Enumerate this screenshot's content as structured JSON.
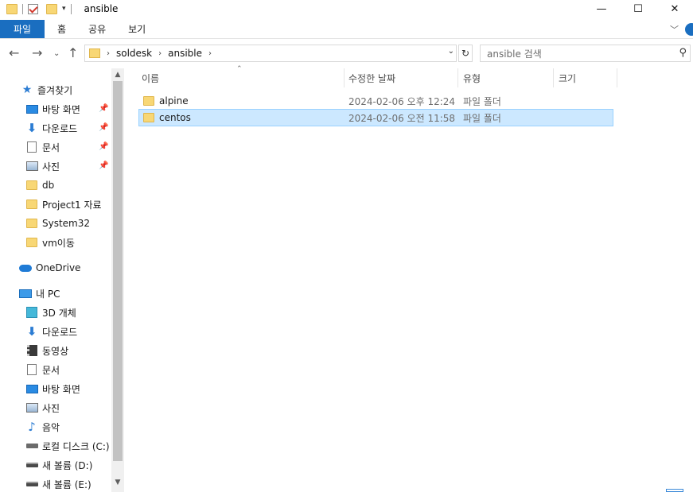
{
  "window": {
    "title": "ansible",
    "controls": {
      "minimize": "—",
      "maximize": "☐",
      "close": "✕"
    }
  },
  "ribbon": {
    "tabs": [
      "파일",
      "홈",
      "공유",
      "보기"
    ],
    "expand_icon": "chevron-down-icon"
  },
  "address": {
    "breadcrumb": [
      "soldesk",
      "ansible"
    ],
    "search_placeholder": "ansible 검색"
  },
  "sidebar": {
    "quick_access": {
      "label": "즐겨찾기"
    },
    "quick_items": [
      {
        "label": "바탕 화면",
        "icon": "desktop-icon",
        "pinned": true
      },
      {
        "label": "다운로드",
        "icon": "download-icon",
        "pinned": true
      },
      {
        "label": "문서",
        "icon": "document-icon",
        "pinned": true
      },
      {
        "label": "사진",
        "icon": "picture-icon",
        "pinned": true
      },
      {
        "label": "db",
        "icon": "folder-icon",
        "pinned": false
      },
      {
        "label": "Project1 자료",
        "icon": "folder-icon",
        "pinned": false
      },
      {
        "label": "System32",
        "icon": "folder-icon",
        "pinned": false
      },
      {
        "label": "vm이동",
        "icon": "folder-icon",
        "pinned": false
      }
    ],
    "onedrive": {
      "label": "OneDrive"
    },
    "this_pc": {
      "label": "내 PC"
    },
    "pc_items": [
      {
        "label": "3D 개체",
        "icon": "3d-objects-icon"
      },
      {
        "label": "다운로드",
        "icon": "download-icon"
      },
      {
        "label": "동영상",
        "icon": "video-icon"
      },
      {
        "label": "문서",
        "icon": "document-icon"
      },
      {
        "label": "바탕 화면",
        "icon": "desktop-icon"
      },
      {
        "label": "사진",
        "icon": "picture-icon"
      },
      {
        "label": "음악",
        "icon": "music-icon"
      },
      {
        "label": "로컬 디스크 (C:)",
        "icon": "local-disk-icon"
      },
      {
        "label": "새 볼륨 (D:)",
        "icon": "drive-icon"
      },
      {
        "label": "새 볼륨 (E:)",
        "icon": "drive-icon"
      }
    ]
  },
  "columns": {
    "name": "이름",
    "date": "수정한 날짜",
    "type": "유형",
    "size": "크기"
  },
  "files": [
    {
      "name": "alpine",
      "date": "2024-02-06 오후 12:24",
      "type": "파일 폴더",
      "selected": false
    },
    {
      "name": "centos",
      "date": "2024-02-06 오전 11:58",
      "type": "파일 폴더",
      "selected": true
    }
  ],
  "colors": {
    "accent": "#1a6ec0",
    "selection_bg": "#cce8ff",
    "selection_border": "#99d1ff",
    "folder": "#f8d775"
  }
}
